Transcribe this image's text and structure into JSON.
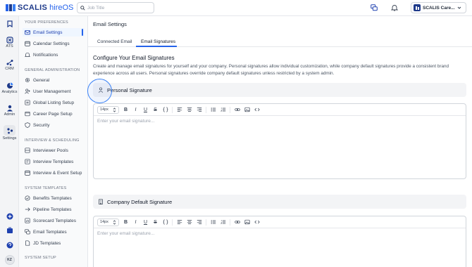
{
  "app": {
    "logo_text": "SCALIS",
    "logo_sub": "hireOS"
  },
  "search": {
    "placeholder": "Job Title"
  },
  "company": {
    "name": "SCALIS Care..."
  },
  "rail": {
    "items": [
      {
        "label": ""
      },
      {
        "label": "ATS"
      },
      {
        "label": "CRM"
      },
      {
        "label": "Analytics"
      },
      {
        "label": "Admin"
      },
      {
        "label": "Settings"
      }
    ],
    "avatar": "KZ"
  },
  "sidebar": {
    "sections": [
      {
        "title": "YOUR PREFERENCES",
        "items": [
          "Email Settings",
          "Calendar Settings",
          "Notifications"
        ]
      },
      {
        "title": "GENERAL ADMINISTRATION",
        "items": [
          "General",
          "User Management",
          "Global Listing Setup",
          "Career Page Setup",
          "Security"
        ]
      },
      {
        "title": "INTERVIEW & SCHEDULING",
        "items": [
          "Interviewer Pools",
          "Interview Templates",
          "Interview & Event Setup"
        ]
      },
      {
        "title": "SYSTEM TEMPLATES",
        "items": [
          "Benefits Templates",
          "Pipeline Templates",
          "Scorecard Templates",
          "Email Templates",
          "JD Templates"
        ]
      },
      {
        "title": "SYSTEM SETUP",
        "items": []
      }
    ]
  },
  "main": {
    "title": "Email Settings",
    "tabs": [
      "Connected Email",
      "Email Signatures"
    ],
    "active_tab": "Email Signatures",
    "heading": "Configure Your Email Signatures",
    "description": "Create and manage email signatures for yourself and your company. Personal signatures allow individual customization, while company default signatures provide a consistent brand experience across all users. Personal signatures override company default signatures unless restricted by a system admin.",
    "personal": {
      "title": "Personal Signature",
      "font_size": "14px",
      "placeholder": "Enter your email signature..."
    },
    "company": {
      "title": "Company Default Signature",
      "font_size": "14px",
      "placeholder": "Enter your email signature..."
    }
  },
  "colors": {
    "brand": "#1e3a8a",
    "accent": "#2563eb"
  }
}
